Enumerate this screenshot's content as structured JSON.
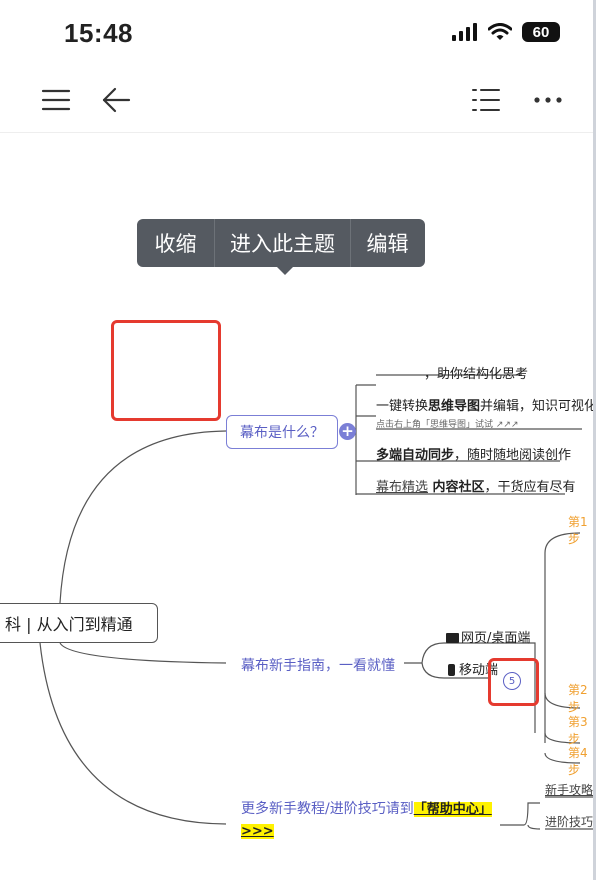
{
  "status": {
    "time": "15:48",
    "battery": "60"
  },
  "toolbar": {
    "menu": "menu-icon",
    "back": "back-arrow-icon",
    "outline": "outline-list-icon",
    "more": "more-icon"
  },
  "popup": {
    "collapse": "收缩",
    "enter": "进入此主题",
    "edit": "编辑"
  },
  "mindmap": {
    "root": "科 | 从入门到精通",
    "topic1": "幕布是什么？",
    "topic1_children": {
      "c1_suffix": "，助你结构化思考",
      "c2_pre": "一键转换",
      "c2_bold": "思维导图",
      "c2_mid": "并编辑，知识可视化",
      "c2_note": "点击右上角「思维导图」试试 ↗↗↗",
      "c3_bold": "多端自动同步",
      "c3_rest": "，随时随地阅读创作",
      "c4_link": "幕布精选",
      "c4_bold": " 内容社区",
      "c4_rest": "，干货应有尽有"
    },
    "topic2": "幕布新手指南，一看就懂",
    "topic2_children": {
      "web": "网页/桌面端",
      "mobile": "移动端",
      "mobile_count": "5"
    },
    "steps": [
      "第1步",
      "第2步",
      "第3步",
      "第4步"
    ],
    "topic3_pre": "更多新手教程/进阶技巧请到",
    "topic3_link": "「帮助中心」",
    "topic3_more": ">>>",
    "topic3_children": [
      "新手攻略",
      "进阶技巧"
    ]
  }
}
